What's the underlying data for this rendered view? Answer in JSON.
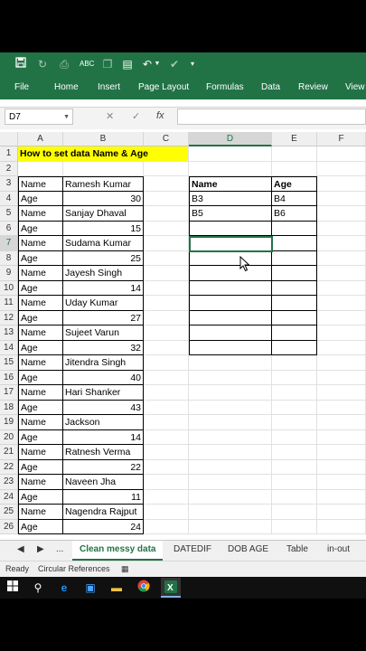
{
  "quick_access": {
    "save_icon": "save-icon",
    "undo_icon": "undo-icon",
    "redo_icon": "redo-icon"
  },
  "ribbon_tabs": [
    "File",
    "Home",
    "Insert",
    "Page Layout",
    "Formulas",
    "Data",
    "Review",
    "View"
  ],
  "formula_bar": {
    "name_box": "D7",
    "cancel": "✕",
    "enter": "✓",
    "fx": "fx"
  },
  "columns": [
    "A",
    "B",
    "C",
    "D",
    "E",
    "F"
  ],
  "rows": [
    "1",
    "2",
    "3",
    "4",
    "5",
    "6",
    "7",
    "8",
    "9",
    "10",
    "11",
    "12",
    "13",
    "14",
    "15",
    "16",
    "17",
    "18",
    "19",
    "20",
    "21",
    "22",
    "23",
    "24",
    "25",
    "26"
  ],
  "title": "How to set data Name & Age",
  "data_rows": [
    {
      "label": "Name",
      "value": "Ramesh Kumar"
    },
    {
      "label": "Age",
      "value": "30"
    },
    {
      "label": "Name",
      "value": "Sanjay Dhaval"
    },
    {
      "label": "Age",
      "value": "15"
    },
    {
      "label": "Name",
      "value": "Sudama Kumar"
    },
    {
      "label": "Age",
      "value": "25"
    },
    {
      "label": "Name",
      "value": "Jayesh Singh"
    },
    {
      "label": "Age",
      "value": "14"
    },
    {
      "label": "Name",
      "value": "Uday Kumar"
    },
    {
      "label": "Age",
      "value": "27"
    },
    {
      "label": "Name",
      "value": "Sujeet Varun"
    },
    {
      "label": "Age",
      "value": "32"
    },
    {
      "label": "Name",
      "value": "Jitendra Singh"
    },
    {
      "label": "Age",
      "value": "40"
    },
    {
      "label": "Name",
      "value": "Hari Shanker"
    },
    {
      "label": "Age",
      "value": "43"
    },
    {
      "label": "Name",
      "value": "Jackson"
    },
    {
      "label": "Age",
      "value": "14"
    },
    {
      "label": "Name",
      "value": "Ratnesh Verma"
    },
    {
      "label": "Age",
      "value": "22"
    },
    {
      "label": "Name",
      "value": "Naveen Jha"
    },
    {
      "label": "Age",
      "value": "11"
    },
    {
      "label": "Name",
      "value": "Nagendra Rajput"
    },
    {
      "label": "Age",
      "value": "24"
    }
  ],
  "output_table": {
    "headers": [
      "Name",
      "Age"
    ],
    "rows": [
      [
        "B3",
        "B4"
      ],
      [
        "B5",
        "B6"
      ],
      [
        "",
        ""
      ],
      [
        "",
        ""
      ],
      [
        "",
        ""
      ],
      [
        "",
        ""
      ],
      [
        "",
        ""
      ],
      [
        "",
        ""
      ],
      [
        "",
        ""
      ]
    ]
  },
  "sheet_tabs": [
    "...",
    "Clean messy data",
    "DATEDIF",
    "DOB AGE",
    "Table",
    "in-out"
  ],
  "status": {
    "ready": "Ready",
    "circular": "Circular References"
  },
  "colors": {
    "excel_green": "#217346",
    "title_fill": "#ffff00"
  }
}
